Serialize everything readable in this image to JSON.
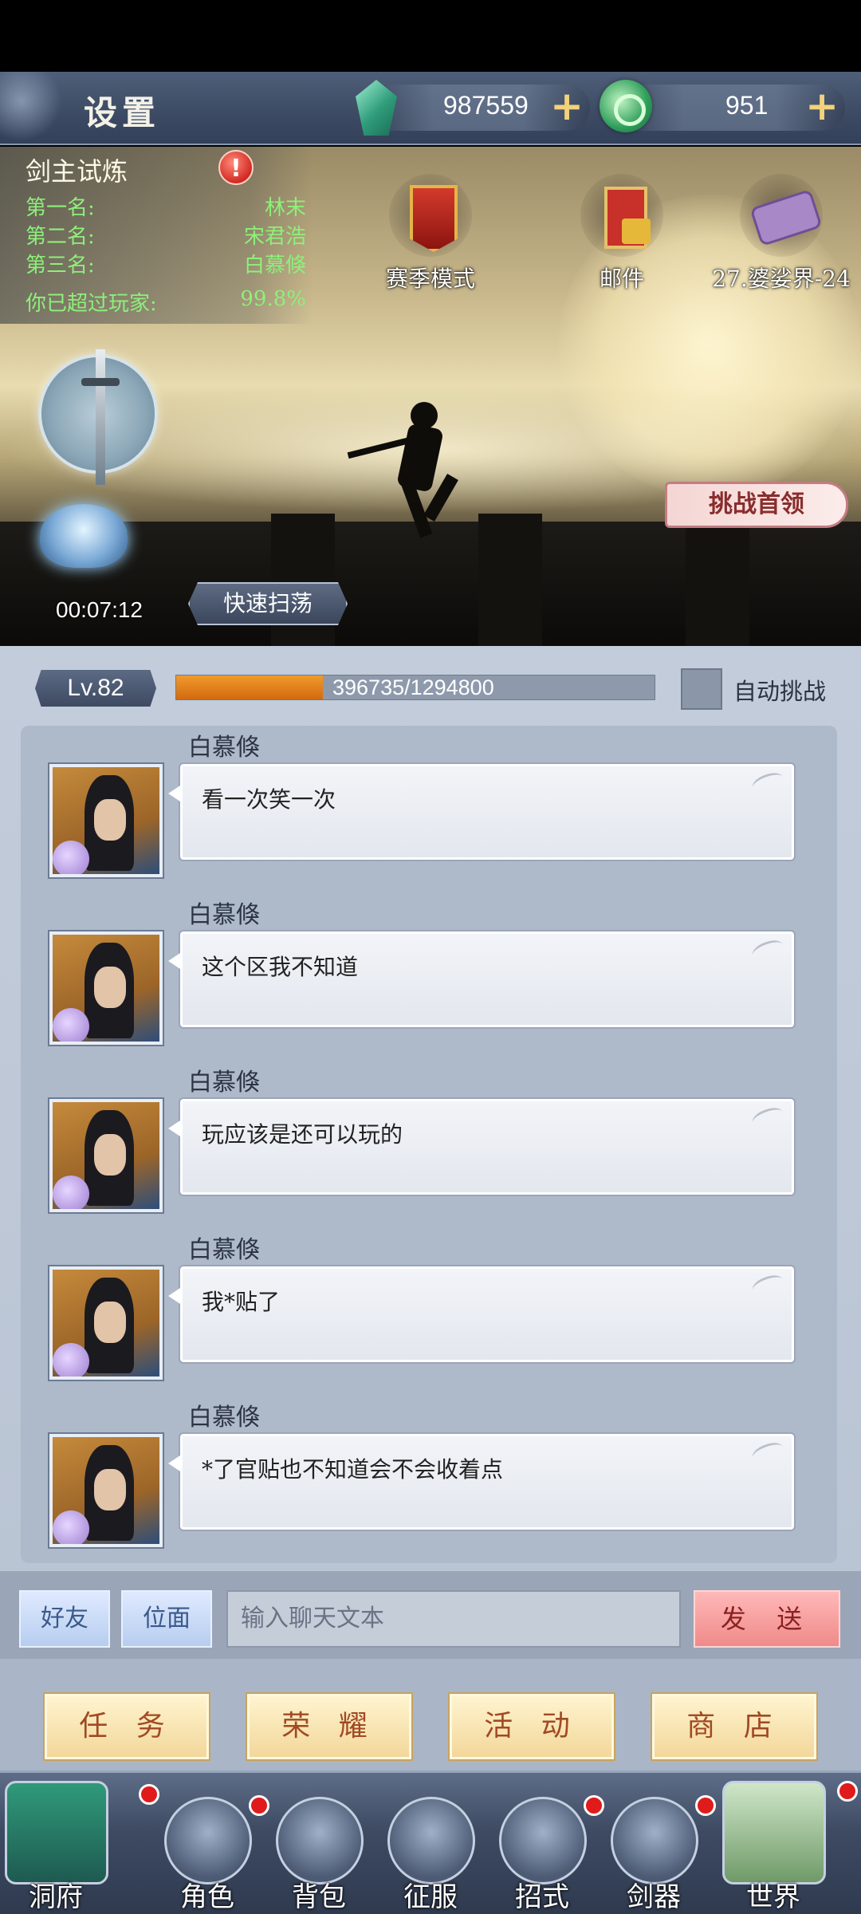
{
  "header": {
    "title": "设置",
    "jade": {
      "value": "987559",
      "plus": "+"
    },
    "coin": {
      "value": "951",
      "plus": "+"
    }
  },
  "trial": {
    "title": "剑主试炼",
    "rows": [
      {
        "label": "第一名:",
        "value": "林末"
      },
      {
        "label": "第二名:",
        "value": "宋君浩"
      },
      {
        "label": "第三名:",
        "value": "白慕倏"
      },
      {
        "label": "你已超过玩家:",
        "value": "99.8%"
      }
    ]
  },
  "scene_buttons": {
    "season": "赛季模式",
    "mail": "邮件",
    "stage": "27.婆娑界-24"
  },
  "challenge_boss": "挑战首领",
  "timer": "00:07:12",
  "quick_sweep": "快速扫荡",
  "level": {
    "label": "Lv.82",
    "xp_text": "396735/1294800",
    "xp_current": 396735,
    "xp_max": 1294800,
    "auto_challenge": "自动挑战"
  },
  "messages": [
    {
      "name": "白慕倏",
      "text": "看一次笑一次"
    },
    {
      "name": "白慕倏",
      "text": "这个区我不知道"
    },
    {
      "name": "白慕倏",
      "text": "玩应该是还可以玩的"
    },
    {
      "name": "白慕倏",
      "text": "我*贴了"
    },
    {
      "name": "白慕倏",
      "text": "*了官贴也不知道会不会收着点"
    }
  ],
  "chat_input": {
    "friends_tab": "好友",
    "plane_tab": "位面",
    "placeholder": "输入聊天文本",
    "send": "发 送"
  },
  "actions": [
    "任 务",
    "荣 耀",
    "活 动",
    "商 店"
  ],
  "nav": [
    {
      "label": "洞府",
      "icon": "cave-house-icon",
      "badge": true
    },
    {
      "label": "角色",
      "icon": "character-icon",
      "badge": true
    },
    {
      "label": "背包",
      "icon": "bag-icon",
      "badge": false
    },
    {
      "label": "征服",
      "icon": "crossed-swords-icon",
      "badge": false
    },
    {
      "label": "招式",
      "icon": "scroll-book-icon",
      "badge": true
    },
    {
      "label": "剑器",
      "icon": "sword-forge-icon",
      "badge": true
    },
    {
      "label": "世界",
      "icon": "world-map-icon",
      "badge": true
    }
  ],
  "colors": {
    "rank_text": "#8df07a",
    "xp_fill": "#e27a18",
    "notification_dot": "#e01b1b",
    "send_button": "#f49a9a",
    "action_button": "#f7e2ae"
  }
}
